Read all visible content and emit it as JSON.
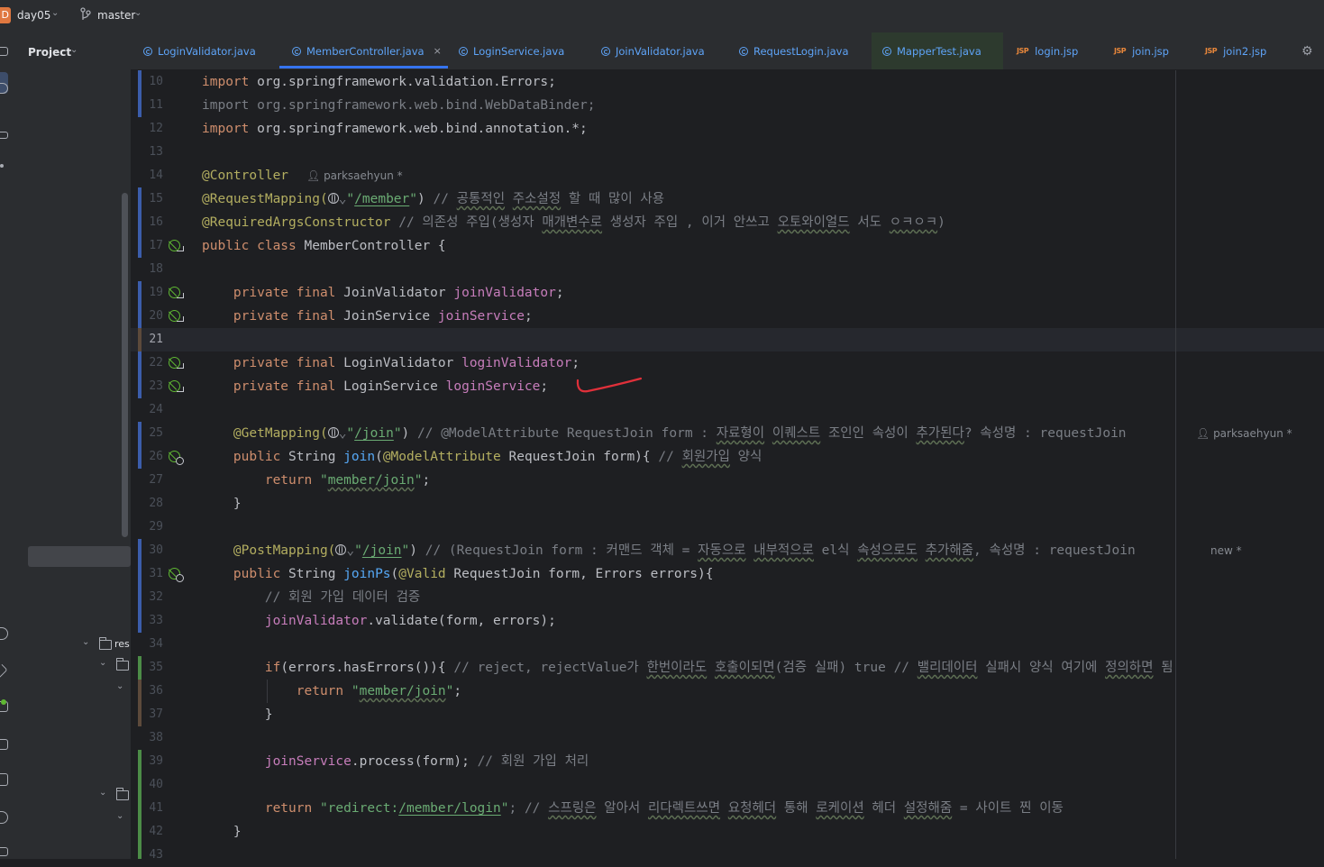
{
  "titlebar": {
    "project_badge": "D",
    "project": "day05",
    "branch": "master"
  },
  "sidebar": {
    "title": "Project",
    "tree_label": "res"
  },
  "tabs": [
    {
      "label": "LoginValidator.java",
      "type": "java"
    },
    {
      "label": "MemberController.java",
      "type": "java",
      "active": true
    },
    {
      "label": "LoginService.java",
      "type": "java"
    },
    {
      "label": "JoinValidator.java",
      "type": "java"
    },
    {
      "label": "RequestLogin.java",
      "type": "java"
    },
    {
      "label": "MapperTest.java",
      "type": "java"
    },
    {
      "label": "login.jsp",
      "type": "jsp"
    },
    {
      "label": "join.jsp",
      "type": "jsp"
    },
    {
      "label": "join2.jsp",
      "type": "jsp"
    }
  ],
  "tab_icon_jsp": "JSP",
  "tab_close": "×",
  "editor": {
    "current_line": "21",
    "lines": [
      {
        "n": "10"
      },
      {
        "n": "11"
      },
      {
        "n": "12"
      },
      {
        "n": "13"
      },
      {
        "n": "14"
      },
      {
        "n": "15"
      },
      {
        "n": "16"
      },
      {
        "n": "17"
      },
      {
        "n": "18"
      },
      {
        "n": "19"
      },
      {
        "n": "20"
      },
      {
        "n": "21"
      },
      {
        "n": "22"
      },
      {
        "n": "23"
      },
      {
        "n": "24"
      },
      {
        "n": "25"
      },
      {
        "n": "26"
      },
      {
        "n": "27"
      },
      {
        "n": "28"
      },
      {
        "n": "29"
      },
      {
        "n": "30"
      },
      {
        "n": "31"
      },
      {
        "n": "32"
      },
      {
        "n": "33"
      },
      {
        "n": "34"
      },
      {
        "n": "35"
      },
      {
        "n": "36"
      },
      {
        "n": "37"
      },
      {
        "n": "38"
      },
      {
        "n": "39"
      },
      {
        "n": "40"
      },
      {
        "n": "41"
      },
      {
        "n": "42"
      },
      {
        "n": "43"
      }
    ],
    "code": {
      "l10_kw": "import",
      "l10_rest": " org.springframework.validation.Errors;",
      "l11": "import org.springframework.web.bind.WebDataBinder;",
      "l12_kw": "import",
      "l12_rest": " org.springframework.web.bind.annotation.*;",
      "l14": "@Controller",
      "l15_a": "@RequestMapping(",
      "l15_b": "\"",
      "l15_c": "/member",
      "l15_d": "\"",
      "l15_e": ") ",
      "l15_f": "// ",
      "l15_g": "공통적인",
      "l15_h": " ",
      "l15_i": "주소설정",
      "l15_j": " 할 때 많이 사용",
      "l16_a": "@RequiredArgsConstructor",
      "l16_b": " // 의존성 주입(생성자 ",
      "l16_c": "매개변수로",
      "l16_d": " 생성자 주입 , 이거 안쓰고 ",
      "l16_e": "오토와이얼드",
      "l16_f": " 서도 ",
      "l16_g": "ㅇㅋㅇㅋ",
      "l16_h": ")",
      "l17_a": "public class",
      "l17_b": " MemberController {",
      "l19_a": "    private final",
      "l19_b": " JoinValidator ",
      "l19_c": "joinValidator",
      "l19_d": ";",
      "l20_a": "    private final",
      "l20_b": " JoinService ",
      "l20_c": "joinService",
      "l20_d": ";",
      "l22_a": "    private final",
      "l22_b": " LoginValidator ",
      "l22_c": "loginValidator",
      "l22_d": ";",
      "l23_a": "    private final",
      "l23_b": " LoginService ",
      "l23_c": "loginService",
      "l23_d": ";",
      "l25_a": "    @GetMapping(",
      "l25_b": "\"",
      "l25_c": "/join",
      "l25_d": "\"",
      "l25_e": ") ",
      "l25_f": "// @ModelAttribute RequestJoin form : ",
      "l25_g": "자료형이",
      "l25_h": " ",
      "l25_i": "이퀘스트",
      "l25_j": " 조인인 속성이 ",
      "l25_k": "추가된다",
      "l25_l": "? 속성명 : requestJoin",
      "l26_a": "    public",
      "l26_b": " String ",
      "l26_c": "join",
      "l26_d": "(",
      "l26_e": "@ModelAttribute",
      "l26_f": " RequestJoin form){ ",
      "l26_g": "// ",
      "l26_h": "회원가입",
      "l26_i": " 양식",
      "l27_a": "        return",
      "l27_b": " \"",
      "l27_c": "member/join",
      "l27_d": "\"",
      "l27_e": ";",
      "l28": "    }",
      "l30_a": "    @PostMapping(",
      "l30_b": "\"",
      "l30_c": "/join",
      "l30_d": "\"",
      "l30_e": ") ",
      "l30_f": "// (RequestJoin form : 커맨드 객체 = ",
      "l30_g": "자동으로",
      "l30_h": " ",
      "l30_i": "내부적으로",
      "l30_j": " el식 ",
      "l30_k": "속성으로도",
      "l30_l": " ",
      "l30_m": "추가해줌",
      "l30_n": ", 속성명 : requestJoin",
      "l31_a": "    public",
      "l31_b": " String ",
      "l31_c": "joinPs",
      "l31_d": "(",
      "l31_e": "@Valid",
      "l31_f": " RequestJoin form, Errors errors){",
      "l32": "        // 회원 가입 데이터 검증",
      "l33_a": "        ",
      "l33_b": "joinValidator",
      "l33_c": ".validate(form, errors);",
      "l35_a": "        if",
      "l35_b": "(errors.hasErrors()){ ",
      "l35_c": "// reject, rejectValue가 ",
      "l35_d": "한번이라도",
      "l35_e": " ",
      "l35_f": "호출이되면",
      "l35_g": "(검증 실패) true // ",
      "l35_h": "밸리데이터",
      "l35_i": " 실패시 양식 여기에 ",
      "l35_j": "정의하면",
      "l35_k": " 됨",
      "l36_a": "            return",
      "l36_b": " \"",
      "l36_c": "member/join",
      "l36_d": "\"",
      "l36_e": ";",
      "l37": "        }",
      "l39_a": "        ",
      "l39_b": "joinService",
      "l39_c": ".process(form); ",
      "l39_d": "// 회원 가입 처리",
      "l41_a": "        return",
      "l41_b": " \"redirect:",
      "l41_c": "/member/login",
      "l41_d": "\"",
      "l41_e": "; // ",
      "l41_f": "스프링은",
      "l41_g": " 알아서 ",
      "l41_h": "리다렉트쓰면",
      "l41_i": " ",
      "l41_j": "요청헤더",
      "l41_k": " 통해 ",
      "l41_l": "로케이션",
      "l41_m": " 헤더 ",
      "l41_n": "설정해줌",
      "l41_o": " = 사이트 찐 이동",
      "l42": "    }"
    },
    "inlay": {
      "author1": "parksaehyun *",
      "author2": "parksaehyun *",
      "author3": "new *"
    }
  },
  "colors": {
    "keyword": "#cf8e6d",
    "annotation": "#b3ae60",
    "string": "#6aab73",
    "comment": "#7a7e85",
    "field": "#c77dbb",
    "method": "#56a8f5",
    "accent": "#3574f0",
    "mark": "#e0303a"
  }
}
